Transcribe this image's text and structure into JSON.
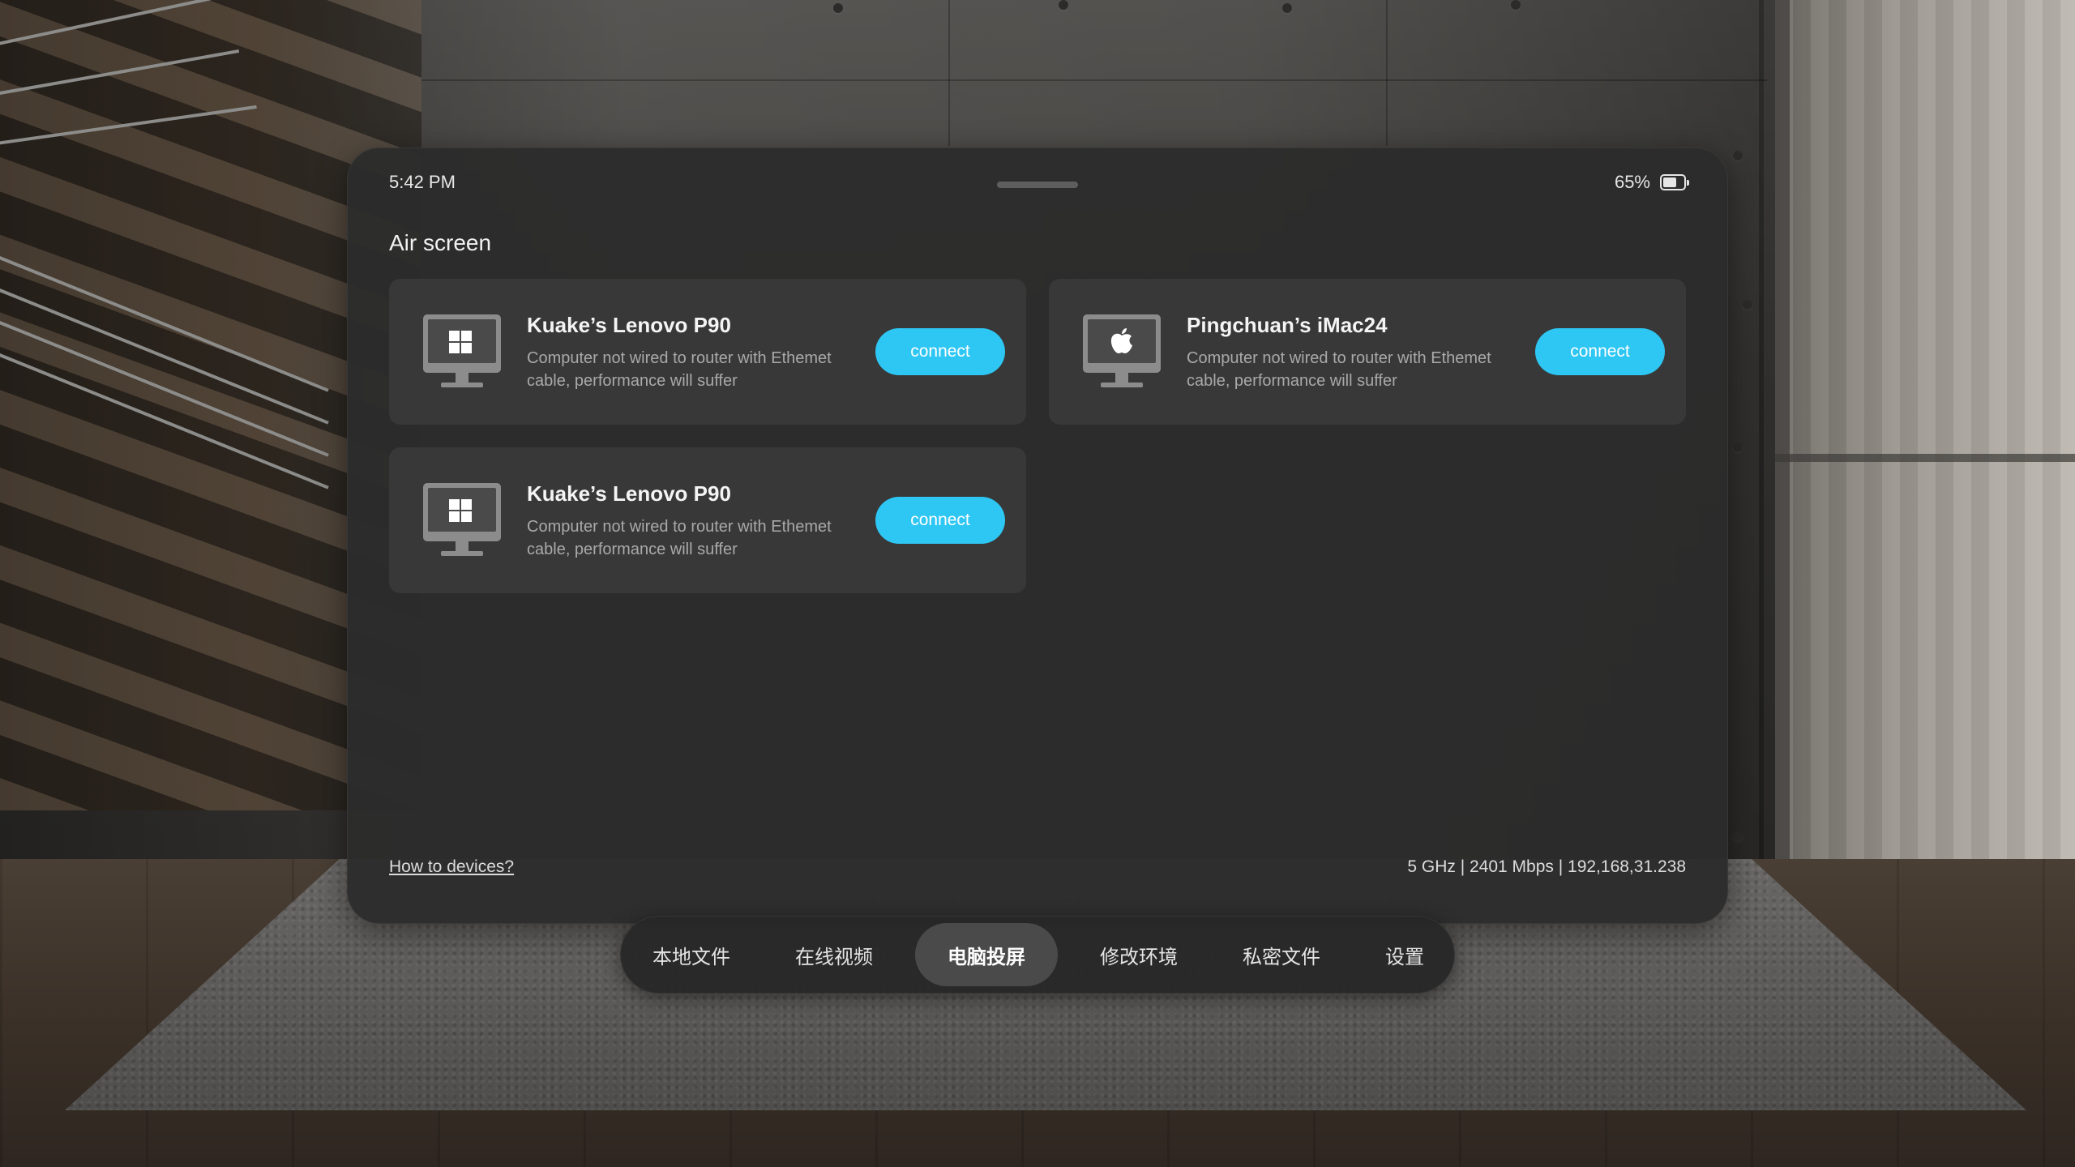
{
  "status_bar": {
    "time": "5:42 PM",
    "battery_percent_text": "65%",
    "battery_level": 0.65,
    "battery_icon": "battery-icon"
  },
  "section": {
    "title": "Air screen"
  },
  "devices": [
    {
      "name": "Kuake’s Lenovo P90",
      "description": "Computer not wired to router with Ethemet cable, performance will suffer",
      "os_icon": "windows-logo-icon",
      "connect_label": "connect"
    },
    {
      "name": "Pingchuan’s iMac24",
      "description": "Computer not wired to router with Ethemet cable, performance will suffer",
      "os_icon": "apple-logo-icon",
      "connect_label": "connect"
    },
    {
      "name": "Kuake’s Lenovo P90",
      "description": "Computer not wired to router with Ethemet cable, performance will suffer",
      "os_icon": "windows-logo-icon",
      "connect_label": "connect"
    }
  ],
  "footer": {
    "help_link": "How to devices?",
    "network_info": "5 GHz | 2401 Mbps | 192,168,31.238"
  },
  "nav": {
    "items": [
      {
        "label": "本地文件",
        "active": false
      },
      {
        "label": "在线视频",
        "active": false
      },
      {
        "label": "电脑投屏",
        "active": true
      },
      {
        "label": "修改环境",
        "active": false
      },
      {
        "label": "私密文件",
        "active": false
      },
      {
        "label": "设置",
        "active": false
      }
    ]
  },
  "colors": {
    "accent": "#2ec6f3",
    "panel": "#2c2c2c",
    "card": "#383838"
  }
}
